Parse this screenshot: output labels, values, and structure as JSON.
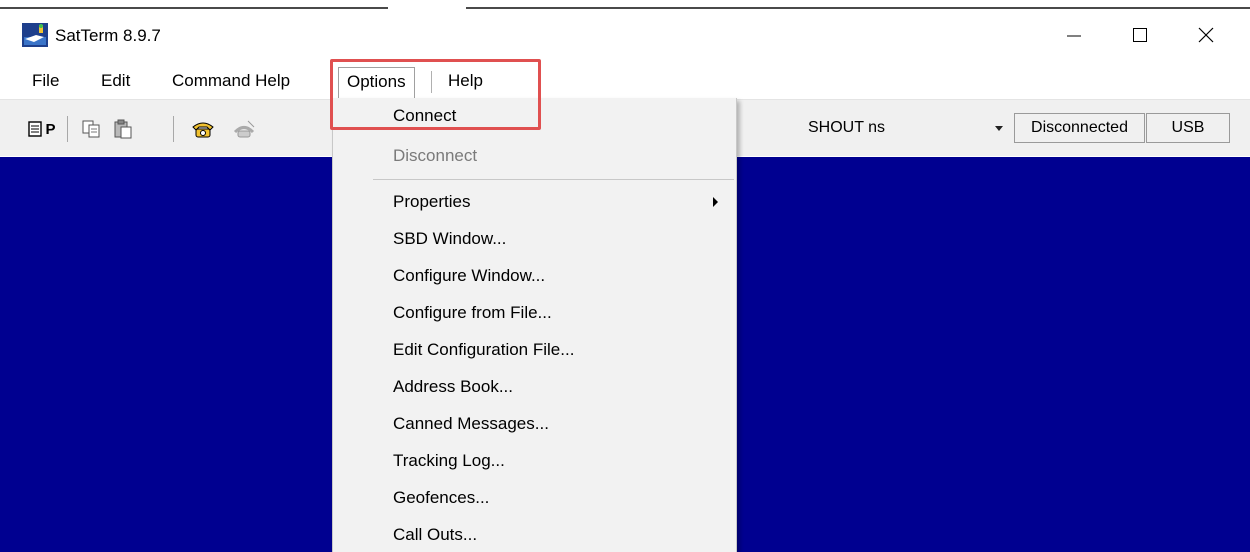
{
  "window": {
    "title": "SatTerm 8.9.7"
  },
  "menubar": {
    "file": "File",
    "edit": "Edit",
    "command_help": "Command Help",
    "options": "Options",
    "help": "Help"
  },
  "toolbar": {
    "print_label": "P",
    "mode_dropdown": {
      "selected": "SHOUT ns"
    },
    "status": "Disconnected",
    "port": "USB"
  },
  "options_menu": {
    "items": [
      {
        "label": "Connect",
        "enabled": true
      },
      {
        "label": "Disconnect",
        "enabled": false
      },
      {
        "label": "Properties",
        "enabled": true,
        "submenu": true
      },
      {
        "label": "SBD Window...",
        "enabled": true
      },
      {
        "label": "Configure Window...",
        "enabled": true
      },
      {
        "label": "Configure from File...",
        "enabled": true
      },
      {
        "label": "Edit Configuration File...",
        "enabled": true
      },
      {
        "label": "Address Book...",
        "enabled": true
      },
      {
        "label": "Canned Messages...",
        "enabled": true
      },
      {
        "label": "Tracking Log...",
        "enabled": true
      },
      {
        "label": "Geofences...",
        "enabled": true
      },
      {
        "label": "Call Outs...",
        "enabled": true
      }
    ]
  },
  "icons": {
    "app": "satellite-terminal-icon",
    "minimize": "minimize-icon",
    "maximize": "maximize-icon",
    "close": "close-icon",
    "print": "print-icon",
    "copy": "copy-icon",
    "paste": "paste-icon",
    "dial": "phone-dial-icon",
    "hangup": "phone-hangup-icon",
    "submenu_arrow": "chevron-right-icon"
  },
  "colors": {
    "terminal_background": "#000090",
    "highlight_annotation": "#e05050"
  }
}
